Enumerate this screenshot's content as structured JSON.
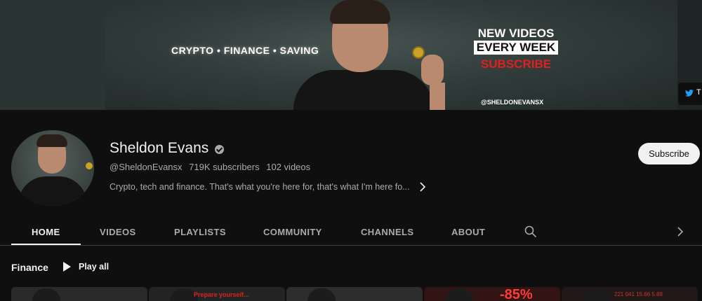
{
  "banner": {
    "tagline": "CRYPTO • FINANCE • SAVING",
    "promo_line1": "NEW VIDEOS",
    "promo_line2": "EVERY WEEK",
    "promo_line3": "SUBSCRIBE",
    "handle": "@SHELDONEVANSX",
    "link_label": "T"
  },
  "channel": {
    "name": "Sheldon Evans",
    "handle": "@SheldonEvansx",
    "subscribers": "719K subscribers",
    "videos": "102 videos",
    "description": "Crypto, tech and finance. That's what you're here for, that's what I'm here fo...",
    "subscribe_label": "Subscribe"
  },
  "tabs": [
    {
      "label": "HOME",
      "active": true
    },
    {
      "label": "VIDEOS"
    },
    {
      "label": "PLAYLISTS"
    },
    {
      "label": "COMMUNITY"
    },
    {
      "label": "CHANNELS"
    },
    {
      "label": "ABOUT"
    }
  ],
  "section": {
    "title": "Finance",
    "play_all": "Play all"
  },
  "thumbnails": [
    {
      "text": ""
    },
    {
      "text": "Prepare yourself..."
    },
    {
      "text": ""
    },
    {
      "text": "-85%"
    },
    {
      "text": "221  041  15.66  5.88"
    }
  ],
  "colors": {
    "background": "#0f0f0f",
    "text_primary": "#f1f1f1",
    "text_secondary": "#aaaaaa",
    "subscribe_bg": "#f1f1f1",
    "accent_red": "#e02020"
  }
}
